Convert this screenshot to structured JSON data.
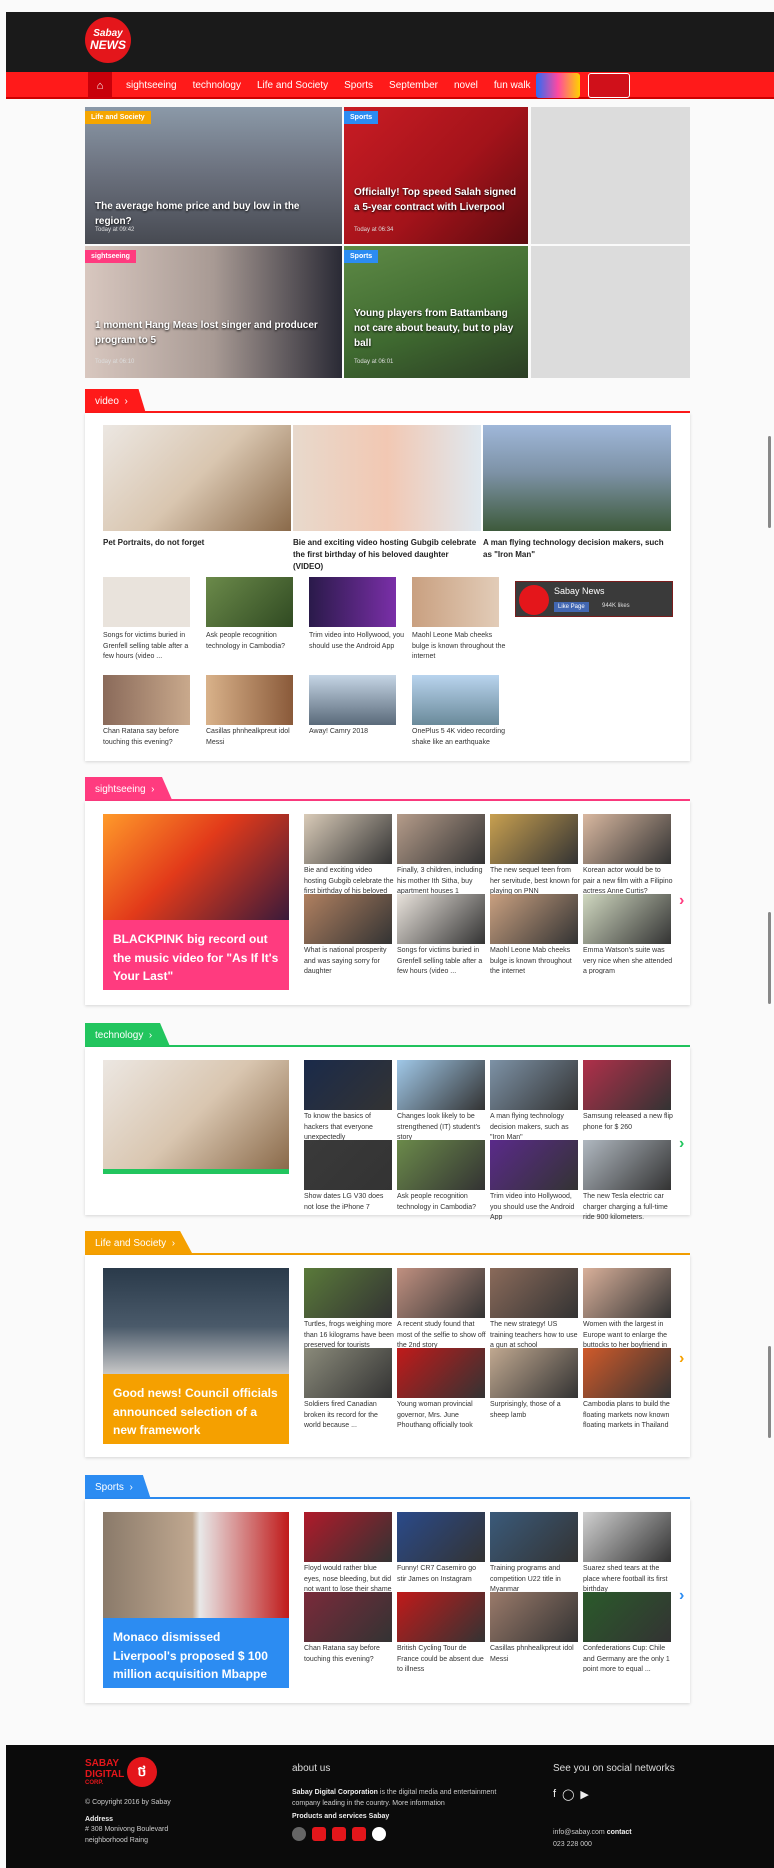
{
  "header": {
    "logo_line1": "Sabay",
    "logo_line2": "NEWS"
  },
  "nav": {
    "home_icon": "home-icon",
    "items": [
      "sightseeing",
      "technology",
      "Life and Society",
      "Sports",
      "September",
      "novel",
      "fun walk"
    ]
  },
  "hero": [
    {
      "tag": "Life and Society",
      "tag_color": "#f5a600",
      "title": "The average home price and buy low in the region?",
      "time": "Today at 09:42"
    },
    {
      "tag": "Sports",
      "tag_color": "#2c8cf2",
      "title": "Officially! Top speed Salah signed a 5-year contract with Liverpool",
      "time": "Today at 06:34"
    },
    {
      "tag": "sightseeing",
      "tag_color": "#ff3b7f",
      "title": "1 moment Hang Meas lost singer and producer program to 5",
      "time": "Today at 06:10"
    },
    {
      "tag": "Sports",
      "tag_color": "#2c8cf2",
      "title": "Young players from Battambang not care about beauty, but to play ball",
      "time": "Today at 06:01"
    }
  ],
  "video": {
    "label": "video",
    "color": "#ff1a1a",
    "main": [
      "Pet Portraits, do not forget",
      "Bie and exciting video hosting Gubgib celebrate the first birthday of his beloved daughter (VIDEO)",
      "A man flying technology decision makers, such as \"Iron Man\""
    ],
    "row2": [
      "Songs for victims buried in Grenfell selling table after a few hours (video ...",
      "Ask people recognition technology in Cambodia?",
      "Trim video into Hollywood, you should use the Android App",
      "Maohl Leone Mab cheeks bulge is known throughout the internet"
    ],
    "row3": [
      "Chan Ratana say before touching this evening?",
      "Casillas phnhealkpreut idol Messi",
      "Away! Camry 2018",
      "OnePlus 5 4K video recording shake like an earthquake"
    ],
    "fb": {
      "name": "Sabay News",
      "like": "Like Page",
      "count": "944K likes"
    }
  },
  "sightseeing": {
    "label": "sightseeing",
    "color": "#ff3b7f",
    "feature": "BLACKPINK big record out the music video for \"As If It's Your Last\"",
    "items": [
      "Bie and exciting video hosting Gubgib celebrate the first birthday of his beloved",
      "Finally, 3 children, including his mother Ith Sitha, buy apartment houses 1",
      "The new sequel teen from her servitude, best known for playing on PNN",
      "Korean actor would be to pair a new film with a Filipino actress Anne Curtis?",
      "What is national prosperity and was saying sorry for daughter",
      "Songs for victims buried in Grenfell selling table after a few hours (video ...",
      "Maohl Leone Mab cheeks bulge is known throughout the internet",
      "Emma Watson's suite was very nice when she attended a program"
    ]
  },
  "technology": {
    "label": "technology",
    "color": "#22c55e",
    "items": [
      "To know the basics of hackers that everyone unexpectedly",
      "Changes look likely to be strengthened (IT) student's story",
      "A man flying technology decision makers, such as \"Iron Man\"",
      "Samsung released a new flip phone for $ 260",
      "Show dates LG V30 does not lose the iPhone 7",
      "Ask people recognition technology in Cambodia?",
      "Trim video into Hollywood, you should use the Android App",
      "The new Tesla electric car charger charging a full-time ride 900 kilometers."
    ]
  },
  "life": {
    "label": "Life and Society",
    "color": "#f5a000",
    "feature": "Good news! Council officials announced selection of a new framework",
    "items": [
      "Turtles, frogs weighing more than 16 kilograms have been preserved for tourists",
      "A recent study found that most of the selfie to show off the 2nd story",
      "The new strategy! US training teachers how to use a gun at school",
      "Women with the largest in Europe want to enlarge the buttocks to her boyfriend in",
      "Soldiers fired Canadian broken its record for the world because ...",
      "Young woman provincial governor, Mrs. June Phouthang officially took",
      "Surprisingly, those of a sheep lamb",
      "Cambodia plans to build the floating markets now known floating markets in Thailand"
    ]
  },
  "sports": {
    "label": "Sports",
    "color": "#2c8cf2",
    "feature": "Monaco dismissed Liverpool's proposed $ 100 million acquisition Mbappe",
    "items": [
      "Floyd would rather blue eyes, nose bleeding, but did not want to lose their shame",
      "Funny! CR7 Casemiro go stir James on Instagram",
      "Training programs and competition U22 title in Myanmar",
      "Suarez shed tears at the place where football its first birthday",
      "Chan Ratana say before touching this evening?",
      "British Cycling Tour de France could be absent due to illness",
      "Casillas phnhealkpreut idol Messi",
      "Confederations Cup: Chile and Germany are the only 1 point more to equal ..."
    ]
  },
  "footer": {
    "logo": [
      "SABAY",
      "DIGITAL",
      "CORP."
    ],
    "copyright": "© Copyright 2016 by Sabay",
    "address_label": "Address",
    "address": "# 308 Monivong Boulevard neighborhood Raing",
    "about_head": "about us",
    "about_strong": "Sabay Digital Corporation",
    "about_text": "is the digital media and entertainment company leading in the country. More information",
    "products_head": "Products and services Sabay",
    "social_head": "See you on social networks",
    "email": "info@sabay.com",
    "contact": "contact",
    "phone": "023 228 000"
  }
}
